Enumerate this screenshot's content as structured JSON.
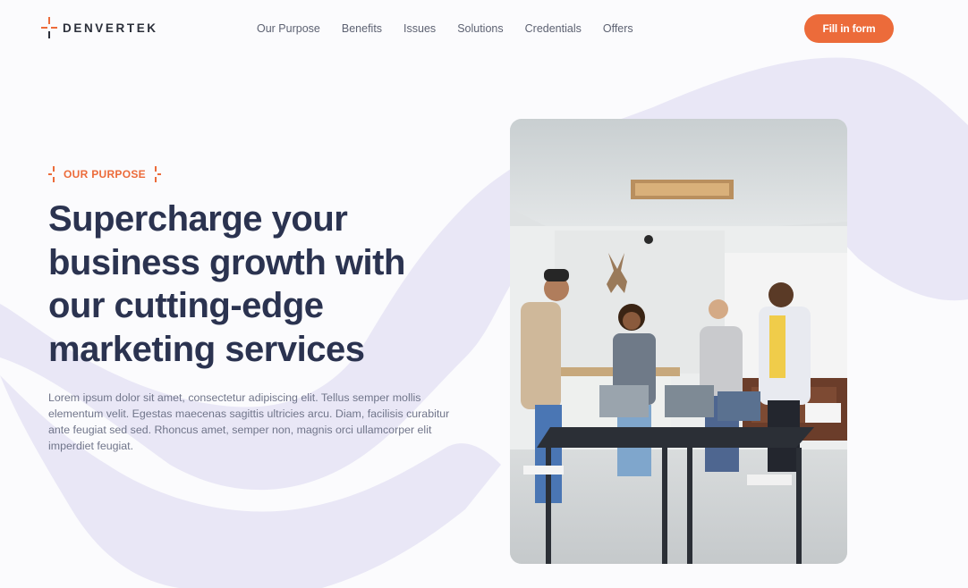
{
  "brand": {
    "name": "DENVERTEK",
    "accent": "#ec6b3a",
    "ink": "#2b3350",
    "wave_color": "#e9e7f6"
  },
  "nav": {
    "items": [
      {
        "label": "Our Purpose"
      },
      {
        "label": "Benefits"
      },
      {
        "label": "Issues"
      },
      {
        "label": "Solutions"
      },
      {
        "label": "Credentials"
      },
      {
        "label": "Offers"
      }
    ],
    "cta_label": "Fill in form"
  },
  "hero": {
    "eyebrow": "OUR PURPOSE",
    "headline": "Supercharge your business growth with our cutting-edge marketing services",
    "body": "Lorem ipsum dolor sit amet, consectetur adipiscing elit. Tellus semper mollis elementum velit. Egestas maecenas sagittis ultricies arcu. Diam, facilisis curabitur ante feugiat sed sed. Rhoncus amet, semper non, magnis orci ullamcorper elit imperdiet feugiat."
  },
  "photo": {
    "subject": "team-meeting-office-photo"
  }
}
